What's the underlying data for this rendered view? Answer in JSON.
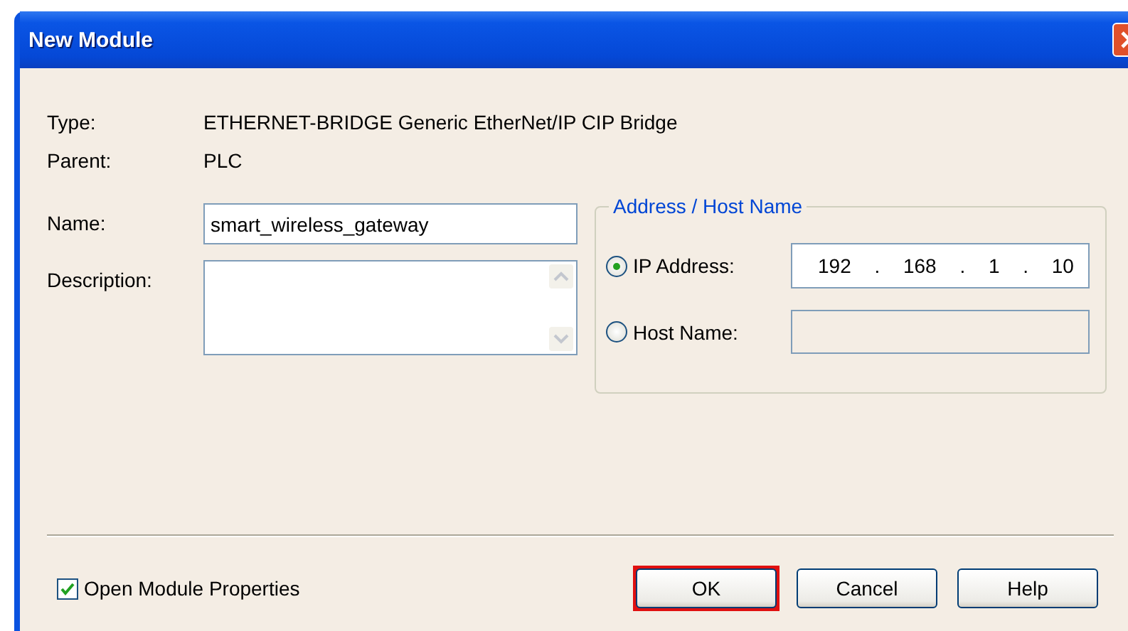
{
  "window": {
    "title": "New Module"
  },
  "info": [
    {
      "label": "Type:",
      "value": "ETHERNET-BRIDGE Generic EtherNet/IP CIP Bridge"
    },
    {
      "label": "Parent:",
      "value": "PLC"
    }
  ],
  "name": {
    "label": "Name:",
    "value": "smart_wireless_gateway"
  },
  "description": {
    "label": "Description:"
  },
  "address_group": {
    "title": "Address / Host Name",
    "options": [
      {
        "kind": "ip",
        "label": "IP Address:",
        "selected": true,
        "octets": [
          "192",
          "168",
          "1",
          "10"
        ],
        "separator": "."
      },
      {
        "kind": "host",
        "label": "Host Name:",
        "selected": false
      }
    ]
  },
  "open_module_properties": {
    "label": "Open Module Properties",
    "checked": true
  },
  "buttons": [
    {
      "label": "OK",
      "highlighted": true
    },
    {
      "label": "Cancel",
      "highlighted": false
    },
    {
      "label": "Help",
      "highlighted": false
    }
  ]
}
